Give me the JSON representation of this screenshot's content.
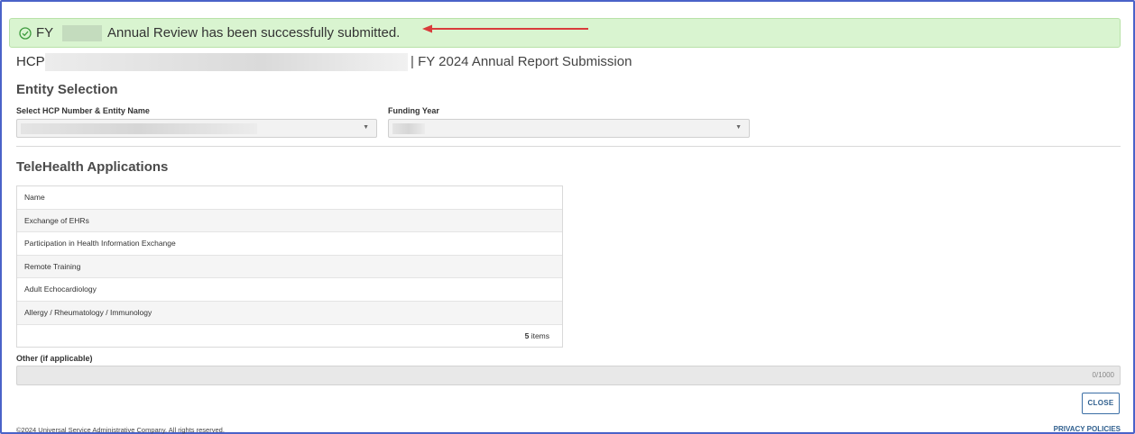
{
  "alert": {
    "prefix": "FY",
    "message": "Annual Review has been successfully submitted."
  },
  "header": {
    "hcp_prefix": "HCP",
    "title": "| FY 2024 Annual Report Submission"
  },
  "entity_selection": {
    "heading": "Entity Selection",
    "hcp_label": "Select HCP Number & Entity Name",
    "funding_label": "Funding Year"
  },
  "telehealth": {
    "heading": "TeleHealth Applications",
    "column_name": "Name",
    "rows": [
      "Exchange of EHRs",
      "Participation in Health Information Exchange",
      "Remote Training",
      "Adult Echocardiology",
      "Allergy / Rheumatology / Immunology"
    ],
    "count": "5",
    "count_suffix": "items"
  },
  "other": {
    "label": "Other (if applicable)",
    "char_count": "0/1000"
  },
  "actions": {
    "close_label": "CLOSE"
  },
  "footer": {
    "copyright": "©2024 Universal Service Administrative Company. All rights reserved.",
    "privacy": "PRIVACY POLICIES"
  },
  "colors": {
    "alert_bg": "#d9f4d0",
    "alert_icon": "#3c9a3c",
    "arrow": "#d93b3b",
    "link": "#2f5f8e",
    "frame": "#4a62c8"
  }
}
